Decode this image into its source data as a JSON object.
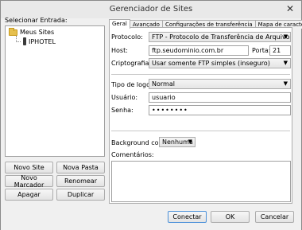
{
  "window": {
    "title": "Gerenciador de Sites",
    "close_glyph": "✕"
  },
  "left": {
    "tree_label": "Selecionar Entrada:",
    "tree": {
      "root": "Meus Sites",
      "site": "IPHOTEL"
    },
    "buttons": {
      "new_site": "Novo Site",
      "new_folder": "Nova Pasta",
      "new_bookmark": "Novo Marcador",
      "rename": "Renomear",
      "delete": "Apagar",
      "duplicate": "Duplicar"
    }
  },
  "tabs": [
    "Geral",
    "Avançado",
    "Configurações de transferência",
    "Mapa de caracteres"
  ],
  "general": {
    "protocol_label": "Protocolo:",
    "protocol_value": "FTP - Protocolo de Transferência de Arquivos",
    "host_label": "Host:",
    "host_value": "ftp.seudominio.com.br",
    "port_label": "Porta:",
    "port_value": "21",
    "encryption_label": "Criptografia",
    "encryption_value": "Usar somente FTP simples (inseguro)",
    "logon_label": "Tipo de logon:",
    "logon_value": "Normal",
    "user_label": "Usuário:",
    "user_value": "usuario",
    "password_label": "Senha:",
    "password_value": "••••••••",
    "bg_color_label": "Background color:",
    "bg_color_value": "Nenhuma",
    "comments_label": "Comentários:"
  },
  "footer": {
    "connect": "Conectar",
    "ok": "OK",
    "cancel": "Cancelar"
  },
  "colors": {
    "folder": "#e6c04e",
    "focus_border": "#4a90d9"
  },
  "icons": {
    "root": "folder-icon",
    "site": "server-icon",
    "dropdown": "chevron-down-icon",
    "close": "close-icon"
  }
}
